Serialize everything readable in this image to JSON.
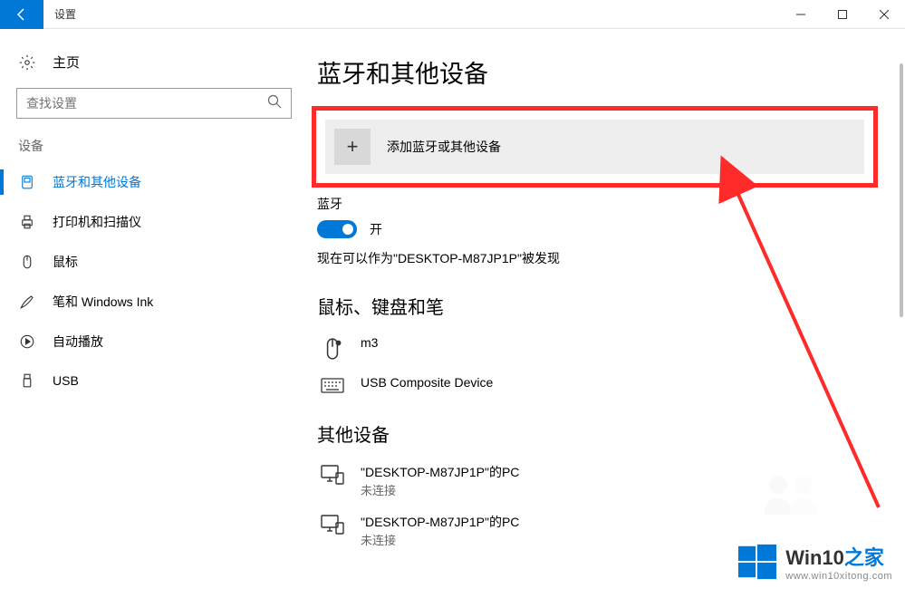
{
  "titlebar": {
    "title": "设置"
  },
  "sidebar": {
    "home": "主页",
    "search_placeholder": "查找设置",
    "section": "设备",
    "items": [
      {
        "label": "蓝牙和其他设备",
        "icon": "bluetooth",
        "active": true
      },
      {
        "label": "打印机和扫描仪",
        "icon": "printer",
        "active": false
      },
      {
        "label": "鼠标",
        "icon": "mouse",
        "active": false
      },
      {
        "label": "笔和 Windows Ink",
        "icon": "pen",
        "active": false
      },
      {
        "label": "自动播放",
        "icon": "autoplay",
        "active": false
      },
      {
        "label": "USB",
        "icon": "usb",
        "active": false
      }
    ]
  },
  "main": {
    "page_title": "蓝牙和其他设备",
    "add_device": "添加蓝牙或其他设备",
    "bluetooth_label": "蓝牙",
    "toggle_state": "开",
    "discovery_text": "现在可以作为\"DESKTOP-M87JP1P\"被发现",
    "group_mouse_kb": "鼠标、键盘和笔",
    "device_m3": "m3",
    "device_usb_composite": "USB Composite Device",
    "group_other": "其他设备",
    "other_devices": [
      {
        "name": "\"DESKTOP-M87JP1P\"的PC",
        "status": "未连接"
      },
      {
        "name": "\"DESKTOP-M87JP1P\"的PC",
        "status": "未连接"
      }
    ]
  },
  "watermark": {
    "brand": "Win10",
    "suffix": "之家",
    "url": "www.win10xitong.com"
  }
}
